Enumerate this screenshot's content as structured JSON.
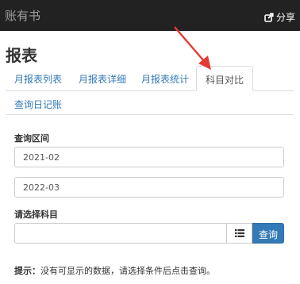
{
  "navbar": {
    "brand": "账有书",
    "share_label": "分享",
    "share_icon": "share-square-icon"
  },
  "page": {
    "title": "报表"
  },
  "tabs": [
    {
      "label": "月报表列表",
      "active": false
    },
    {
      "label": "月报表详细",
      "active": false
    },
    {
      "label": "月报表统计",
      "active": false
    },
    {
      "label": "科目对比",
      "active": true
    },
    {
      "label": "查询日记账",
      "active": false
    }
  ],
  "form": {
    "range_label": "查询区间",
    "start_value": "2021-02",
    "end_value": "2022-03",
    "subject_label": "请选择科目",
    "subject_value": "",
    "list_icon": "list-icon",
    "search_button": "查询"
  },
  "hint": {
    "prefix": "提示：",
    "text": "没有可显示的数据，请选择条件后点击查询。"
  },
  "colors": {
    "navbar_bg": "#222222",
    "link": "#337ab7",
    "primary_button": "#337ab7",
    "annotation_arrow": "#e53935"
  }
}
